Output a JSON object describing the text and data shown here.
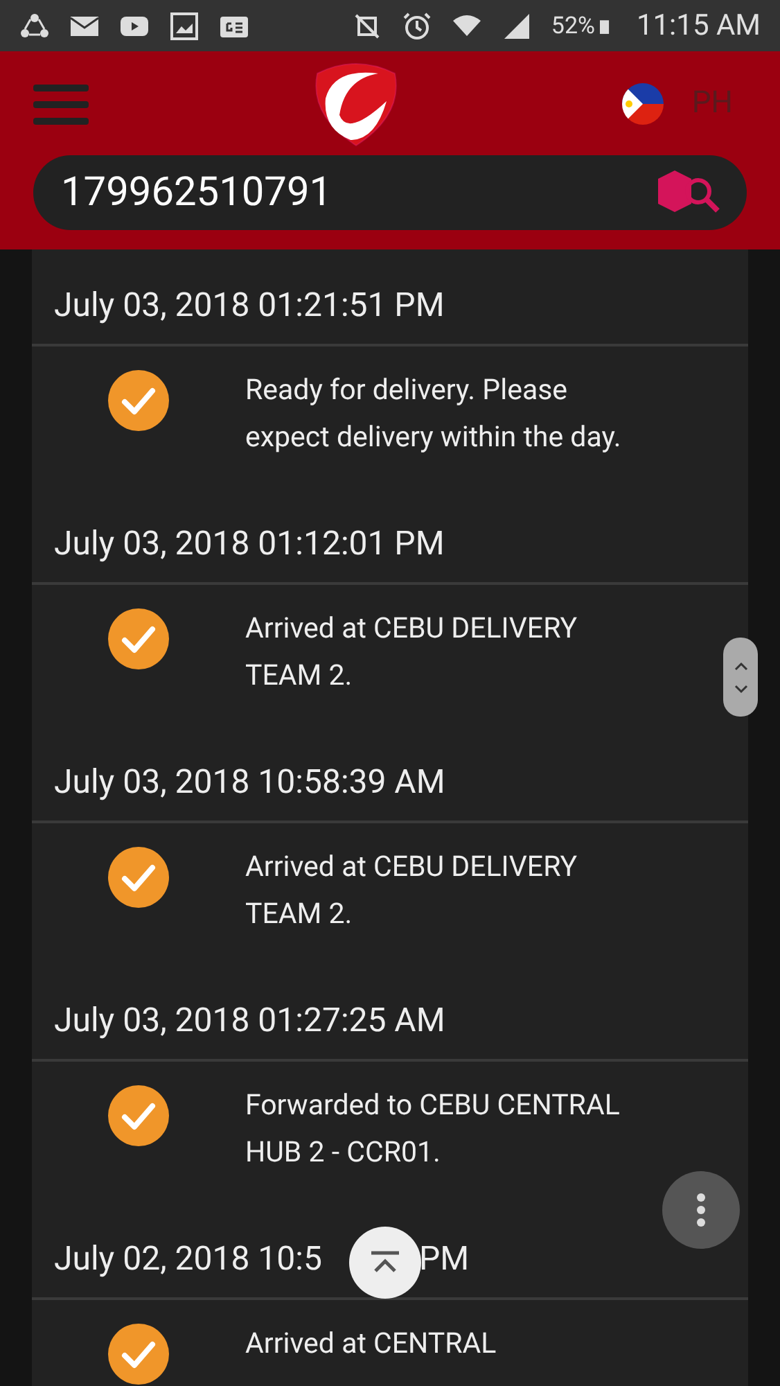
{
  "status_bar": {
    "battery": "52%",
    "time": "11:15 AM"
  },
  "header": {
    "region": "PH"
  },
  "search": {
    "value": "179962510791"
  },
  "events": [
    {
      "date": "July 03, 2018 01:21:51 PM",
      "status": "Ready for delivery. Please expect delivery within the day.",
      "done": true
    },
    {
      "date": "July 03, 2018 01:12:01 PM",
      "status": "Arrived at CEBU DELIVERY TEAM 2.",
      "done": true
    },
    {
      "date": "July 03, 2018 10:58:39 AM",
      "status": "Arrived at CEBU DELIVERY TEAM 2.",
      "done": true
    },
    {
      "date": "July 03, 2018 01:27:25 AM",
      "status": "Forwarded to CEBU CENTRAL HUB 2 - CCR01.",
      "done": true
    },
    {
      "date": "July 02, 2018 10:5",
      "date_suffix": "PM",
      "status": "Arrived at CENTRAL",
      "done": true
    }
  ]
}
